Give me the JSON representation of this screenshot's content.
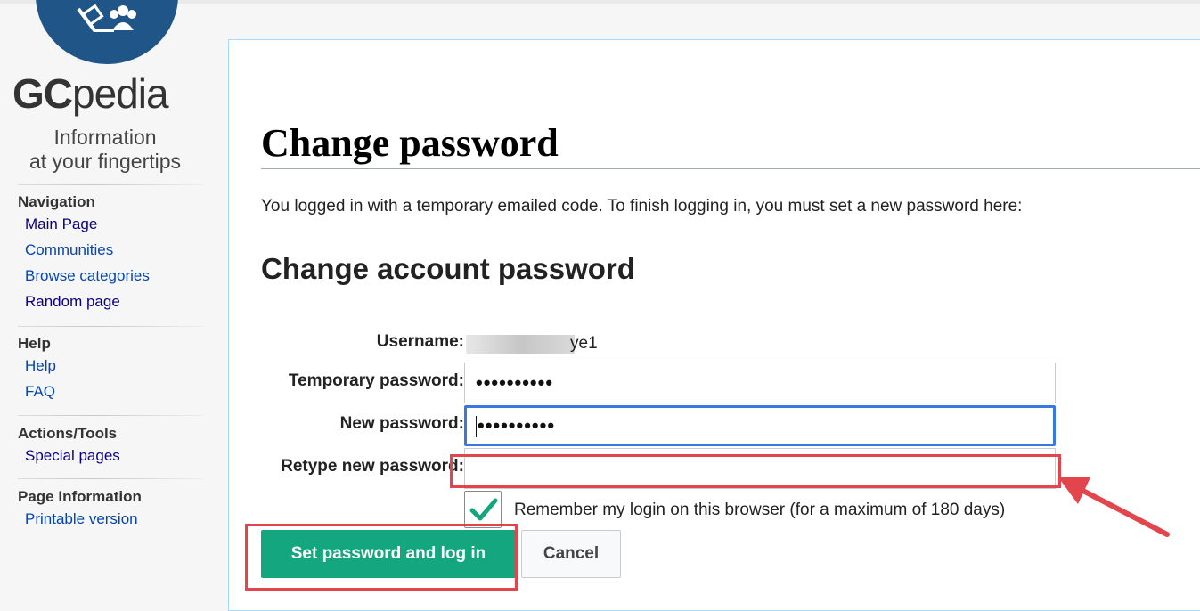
{
  "sidebar": {
    "logo": {
      "brand_bold": "GC",
      "brand_rest": "pedia",
      "tagline_line1": "Information",
      "tagline_line2": "at your fingertips"
    },
    "sections": [
      {
        "heading": "Navigation",
        "items": [
          "Main Page",
          "Communities",
          "Browse categories",
          "Random page"
        ]
      },
      {
        "heading": "Help",
        "items": [
          "Help",
          "FAQ"
        ]
      },
      {
        "heading": "Actions/Tools",
        "items": [
          "Special pages"
        ]
      },
      {
        "heading": "Page Information",
        "items": [
          "Printable version"
        ]
      }
    ]
  },
  "main": {
    "title": "Change password",
    "intro": "You logged in with a temporary emailed code. To finish logging in, you must set a new password here:",
    "form_heading": "Change account password",
    "username_label": "Username:",
    "username_value": "ye1",
    "temp_password_label": "Temporary password:",
    "temp_password_value": "••••••••••",
    "new_password_label": "New password:",
    "new_password_value": "••••••••••",
    "retype_label": "Retype new password:",
    "retype_value": "",
    "remember_label": "Remember my login on this browser (for a maximum of 180 days)",
    "remember_checked": true,
    "submit_label": "Set password and log in",
    "cancel_label": "Cancel"
  },
  "colors": {
    "link": "#0645ad",
    "primary_button": "#14a67e",
    "focus_border": "#3a78e0",
    "annotation_red": "#e3454c",
    "logo_blue": "#1f5687"
  }
}
